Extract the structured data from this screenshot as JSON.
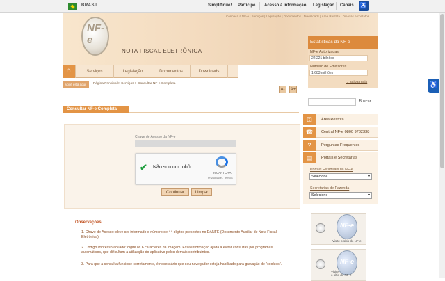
{
  "gov_bar": {
    "country": "BRASIL",
    "links": [
      "Simplifique!",
      "Participe",
      "Acesso à informação",
      "Legislação",
      "Canais"
    ]
  },
  "header": {
    "logo_text": "NF-e",
    "title": "NOTA FISCAL ELETRÔNICA",
    "top_links": "Conheça a NF-e  |  Serviços  |  Legislação  |  Documentos  |  Downloads  |  Área Restrita  |  Dúvidas e contatos"
  },
  "menu": {
    "items": [
      "Serviços",
      "Legislação",
      "Documentos",
      "Downloads"
    ]
  },
  "breadcrumb": {
    "you_are_here": "Você está aqui:",
    "path": "Página Principal > Serviços > Consultar NF-e Completa",
    "font_down": "A-",
    "font_up": "A+"
  },
  "page": {
    "title": "Consultar NF-e Completa",
    "chave_label": "Chave de Acesso da NF-e",
    "chave_value": "",
    "captcha_label": "Não sou um robô",
    "captcha_brand": "reCAPTCHA",
    "captcha_terms": "Privacidade - Termos",
    "continue_button": "Continuar",
    "clear_button": "Limpar"
  },
  "observations": {
    "title": "Observações",
    "items": [
      "1. Chave de Acesso: deve ser informado o número de 44 dígitos presentes no DANFE (Documento Auxiliar de Nota Fiscal Eletrônica).",
      "2. Código impresso ao lado: digite os 6 caracteres da imagem. Essa informação ajuda a evitar consultas por programas automáticos, que dificultam a utilização do aplicativo pelos demais contribuintes.",
      "3. Para que a consulta funcione corretamente, é necessário que seu navegador esteja habilitado para gravação de \"cookies\"."
    ]
  },
  "sidebar": {
    "stats_title": "Estatísticas da NF-e",
    "authorized_label": "NF-e Autorizadas",
    "authorized_value": "22,221 bilhões",
    "issuers_label": "Número de Emissores",
    "issuers_value": "1,683 milhões",
    "saiba_mais": "... saiba mais",
    "search_placeholder": "",
    "search_button": "Buscar",
    "items": [
      {
        "icon": "key-icon",
        "glyph": "⚿",
        "label": "Área Restrita"
      },
      {
        "icon": "phone-icon",
        "glyph": "☎",
        "label": "Central NF-e 0800 9782338"
      },
      {
        "icon": "question-icon",
        "glyph": "?",
        "label": "Perguntas Frequentes"
      },
      {
        "icon": "portal-icon",
        "glyph": "▤",
        "label": "Portais e Secretarias"
      }
    ],
    "portais_label": "Portais Estaduais da NF-e",
    "portais_value": "Selecione",
    "secretarias_label": "Secretarias de Fazenda",
    "secretarias_value": "Selecione",
    "video1": "Visite o sítio do NF-e",
    "video2a": "Visite",
    "video2b": "o sítio do NF-e"
  },
  "colors": {
    "accent": "#e39445",
    "banner": "#f4dcc0",
    "obs_text": "#8a4b20"
  }
}
